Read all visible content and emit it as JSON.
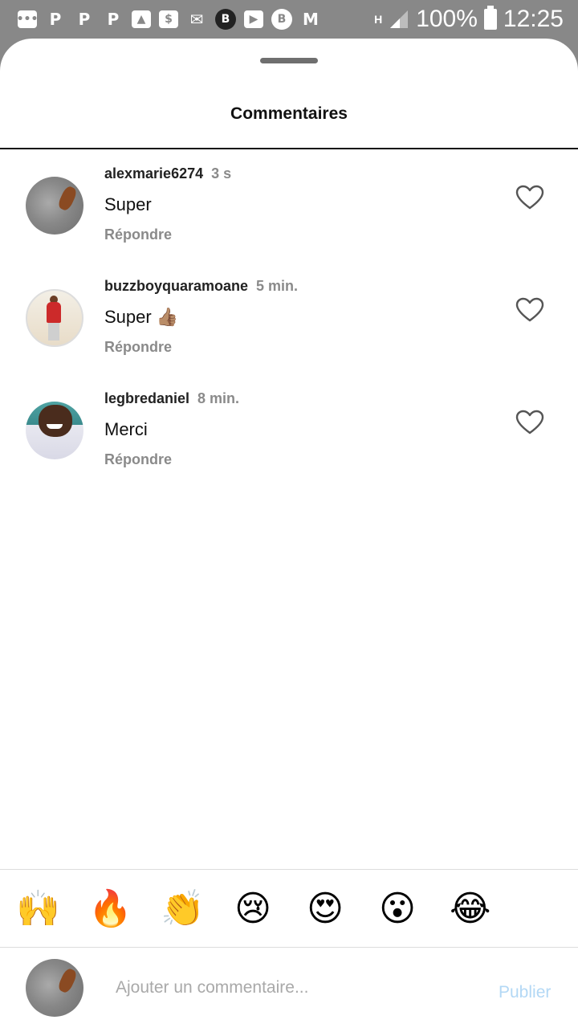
{
  "status_bar": {
    "left_icons": [
      "message-icon",
      "p-icon",
      "p-icon",
      "p-icon",
      "image-icon",
      "dollar-icon",
      "mail-icon",
      "b-icon",
      "youtube-icon",
      "b-circle-icon",
      "gmail-icon"
    ],
    "network": "H",
    "battery": "100%",
    "time": "12:25"
  },
  "sheet": {
    "title": "Commentaires"
  },
  "comments": [
    {
      "username": "alexmarie6274",
      "time": "3 s",
      "text": "Super",
      "reply_label": "Répondre"
    },
    {
      "username": "buzzboyquaramoane",
      "time": "5 min.",
      "text": "Super 👍🏽",
      "reply_label": "Répondre"
    },
    {
      "username": "legbredaniel",
      "time": "8 min.",
      "text": "Merci",
      "reply_label": "Répondre"
    }
  ],
  "emoji_bar": [
    "🙌",
    "🔥",
    "👏",
    "😢",
    "😍",
    "😮",
    "😂"
  ],
  "composer": {
    "placeholder": "Ajouter un commentaire...",
    "publish_label": "Publier"
  },
  "colors": {
    "status_bar_bg": "#888888",
    "publish_disabled": "#b3d8f5",
    "secondary_text": "#8a8a8a"
  }
}
